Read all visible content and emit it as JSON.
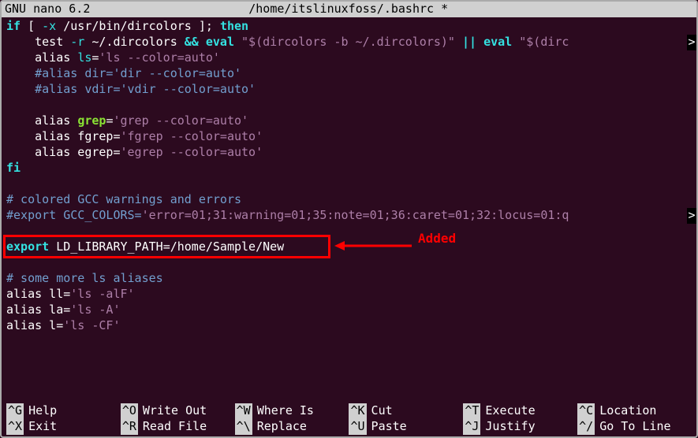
{
  "titlebar": {
    "app": "GNU nano 6.2",
    "filename": "/home/itslinuxfoss/.bashrc *"
  },
  "code": {
    "l1_if": "if",
    "l1_bracket1": " [ ",
    "l1_flag": "-x",
    "l1_path": " /usr/bin/dircolors ",
    "l1_bracket2": "]; ",
    "l1_then": "then",
    "l2_indent": "    test ",
    "l2_flag": "-r",
    "l2_path": " ~/.dircolors ",
    "l2_and": "&&",
    "l2_sp": " ",
    "l2_eval": "eval",
    "l2_sp2": " ",
    "l2_str1": "\"$(dircolors -b ~/.dircolors)\"",
    "l2_sp3": " ",
    "l2_or": "||",
    "l2_sp4": " ",
    "l2_eval2": "eval",
    "l2_sp5": " ",
    "l2_str2": "\"$(dirc",
    "l3_indent": "    alias ",
    "l3_ls": "ls",
    "l3_eq": "=",
    "l3_str": "'ls --color=auto'",
    "l4": "    #alias dir='dir --color=auto'",
    "l5": "    #alias vdir='vdir --color=auto'",
    "l7_indent": "    alias ",
    "l7_grep": "grep",
    "l7_eq": "=",
    "l7_str": "'grep --color=auto'",
    "l8_indent": "    alias fgrep",
    "l8_eq": "=",
    "l8_str": "'fgrep --color=auto'",
    "l9_indent": "    alias egrep",
    "l9_eq": "=",
    "l9_str": "'egrep --color=auto'",
    "l10_fi": "fi",
    "l12": "# colored GCC warnings and errors",
    "l13_a": "#export GCC_COLORS=",
    "l13_b": "'error=01;31:warning=01;35:note=01;36:caret=01;32:locus=01:q",
    "l15_export": "export",
    "l15_sp": " ",
    "l15_var": "LD_LIBRARY_PATH",
    "l15_eq": "=",
    "l15_val": "/home/Sample/New",
    "l17": "# some more ls aliases",
    "l18_a": "alias ll",
    "l18_eq": "=",
    "l18_str": "'ls -alF'",
    "l19_a": "alias la",
    "l19_eq": "=",
    "l19_str": "'ls -A'",
    "l20_a": "alias l",
    "l20_eq": "=",
    "l20_str": "'ls -CF'"
  },
  "annotation": {
    "label": "Added"
  },
  "help": {
    "r1c1_k": "^G",
    "r1c1_l": "Help",
    "r1c2_k": "^O",
    "r1c2_l": "Write Out",
    "r1c3_k": "^W",
    "r1c3_l": "Where Is",
    "r1c4_k": "^K",
    "r1c4_l": "Cut",
    "r1c5_k": "^T",
    "r1c5_l": "Execute",
    "r1c6_k": "^C",
    "r1c6_l": "Location",
    "r2c1_k": "^X",
    "r2c1_l": "Exit",
    "r2c2_k": "^R",
    "r2c2_l": "Read File",
    "r2c3_k": "^\\",
    "r2c3_l": "Replace",
    "r2c4_k": "^U",
    "r2c4_l": "Paste",
    "r2c5_k": "^J",
    "r2c5_l": "Justify",
    "r2c6_k": "^/",
    "r2c6_l": "Go To Line"
  }
}
